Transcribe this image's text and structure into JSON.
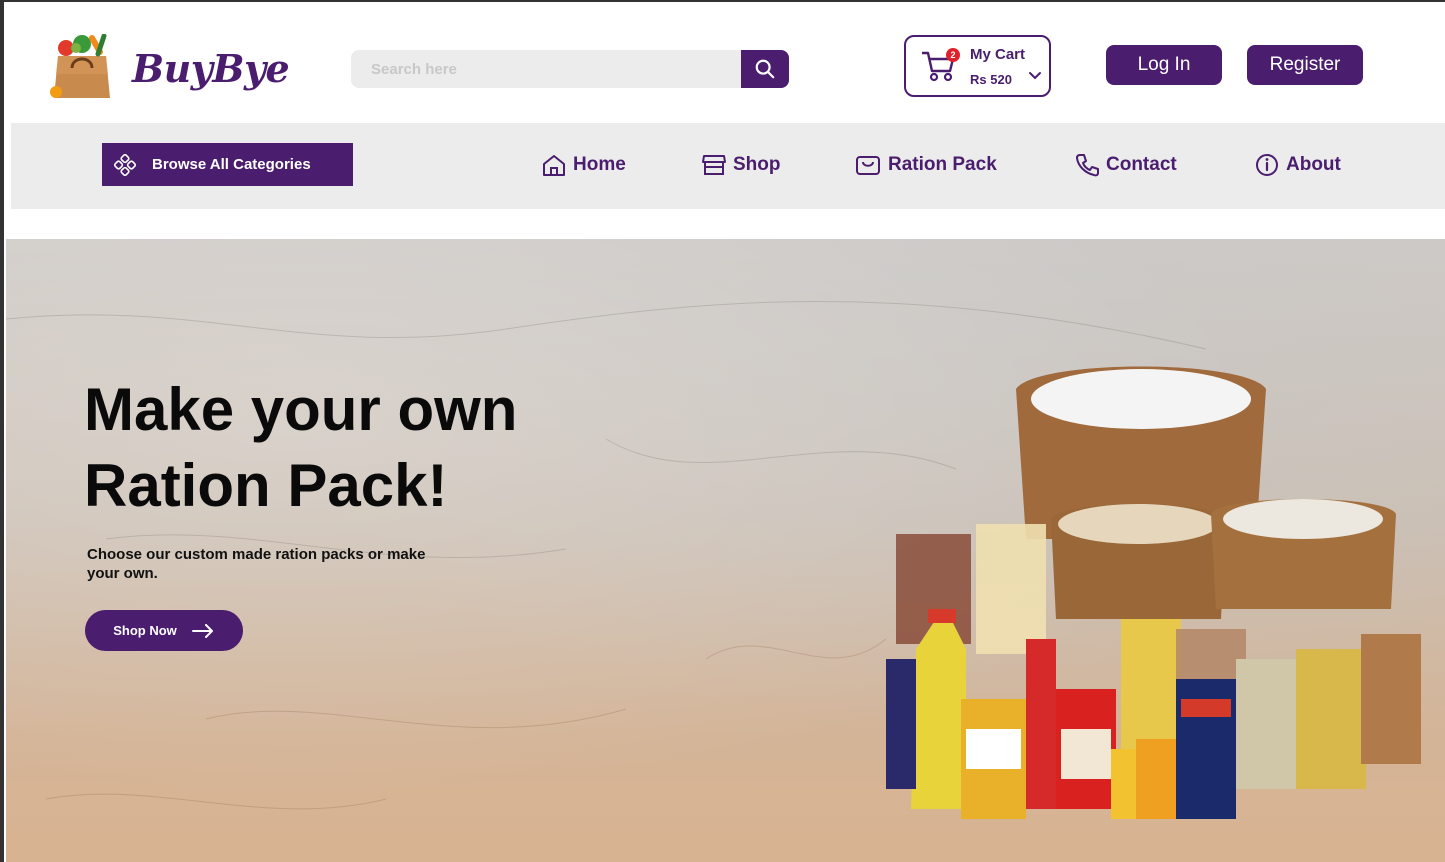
{
  "brand": {
    "name": "BuyBye"
  },
  "search": {
    "placeholder": "Search here"
  },
  "cart": {
    "title": "My Cart",
    "total": "Rs 520",
    "count": "2"
  },
  "auth": {
    "login_label": "Log In",
    "register_label": "Register"
  },
  "nav": {
    "browse_label": "Browse All Categories",
    "items": [
      {
        "label": "Home",
        "icon": "home-icon"
      },
      {
        "label": "Shop",
        "icon": "store-icon"
      },
      {
        "label": "Ration Pack",
        "icon": "bag-icon"
      },
      {
        "label": "Contact",
        "icon": "phone-icon"
      },
      {
        "label": "About",
        "icon": "info-icon"
      }
    ]
  },
  "hero": {
    "title_line1": "Make your own",
    "title_line2": "Ration Pack!",
    "subtitle": "Choose our custom made ration packs or make your own.",
    "cta_label": "Shop Now"
  },
  "colors": {
    "brand": "#4a1d6e",
    "badge": "#e0202a",
    "nav_bg": "#ececec"
  }
}
